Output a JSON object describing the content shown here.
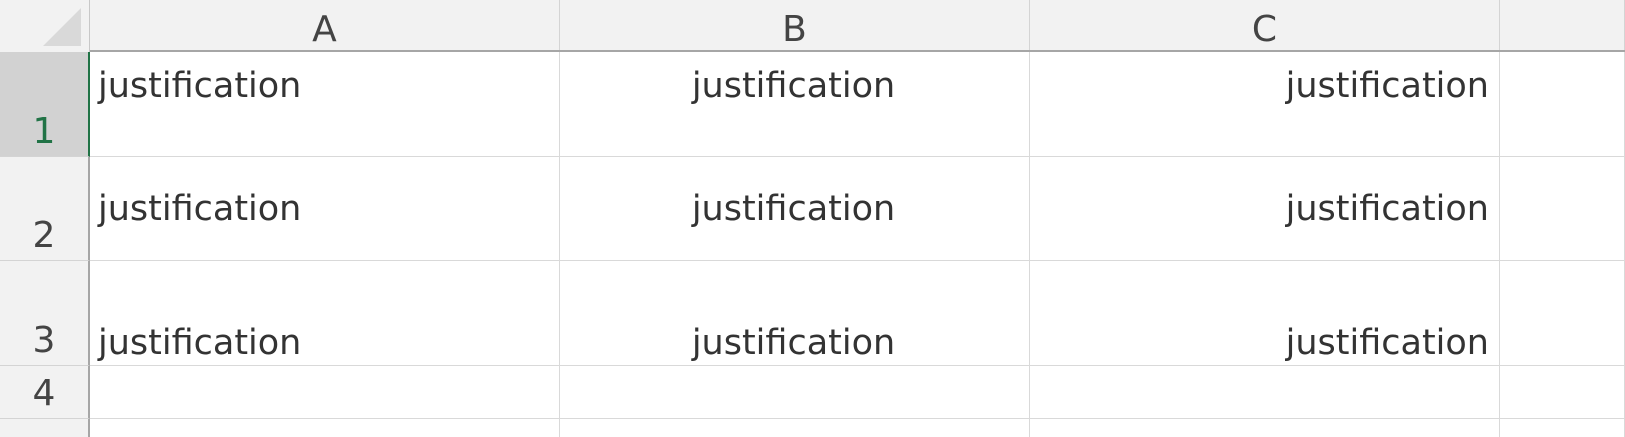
{
  "columns": [
    {
      "label": "A"
    },
    {
      "label": "B"
    },
    {
      "label": "C"
    }
  ],
  "rows": [
    {
      "label": "1",
      "cells": [
        "justification",
        "justification",
        "justification"
      ]
    },
    {
      "label": "2",
      "cells": [
        "justification",
        "justification",
        "justification"
      ]
    },
    {
      "label": "3",
      "cells": [
        "justification",
        "justification",
        "justification"
      ]
    },
    {
      "label": "4",
      "cells": [
        "",
        "",
        ""
      ]
    }
  ],
  "selected_row": "1",
  "colors": {
    "header_bg": "#f2f2f2",
    "selected_accent": "#217346",
    "gridline": "#d9d9d9"
  }
}
